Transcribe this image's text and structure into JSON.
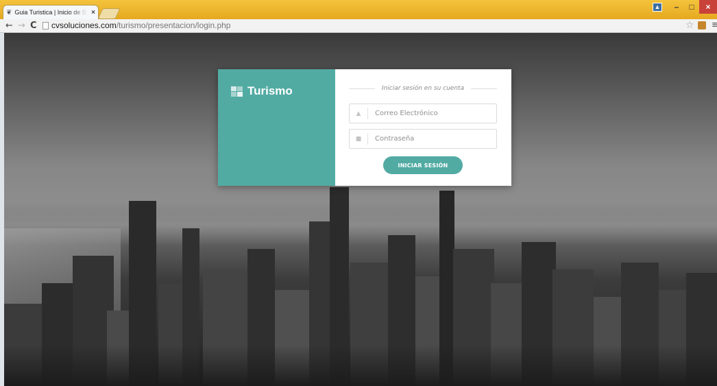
{
  "browser": {
    "tab_title": "Guia Turistica | Inicio de S",
    "tab_close": "×",
    "url_domain": "cvsoluciones.com",
    "url_path": "/turismo/presentacion/login.php",
    "nav": {
      "back": "←",
      "forward": "→",
      "reload": "C"
    },
    "window_controls": {
      "minimize": "–",
      "maximize": "□",
      "close": "×"
    },
    "star": "☆",
    "menu": "≡"
  },
  "login": {
    "brand": "Turismo",
    "heading": "Iniciar sesión en su cuenta",
    "email_placeholder": "Correo Electrónico",
    "password_placeholder": "Contraseña",
    "submit_label": "INICIAR SESIÓN"
  },
  "colors": {
    "accent": "#52aba3",
    "titlebar": "#e5a91f",
    "close_button": "#c9423a"
  },
  "icons": {
    "favicon": "leaf-icon",
    "user_field": "user-icon",
    "password_field": "lock-icon",
    "brand": "grid-logo-icon"
  }
}
